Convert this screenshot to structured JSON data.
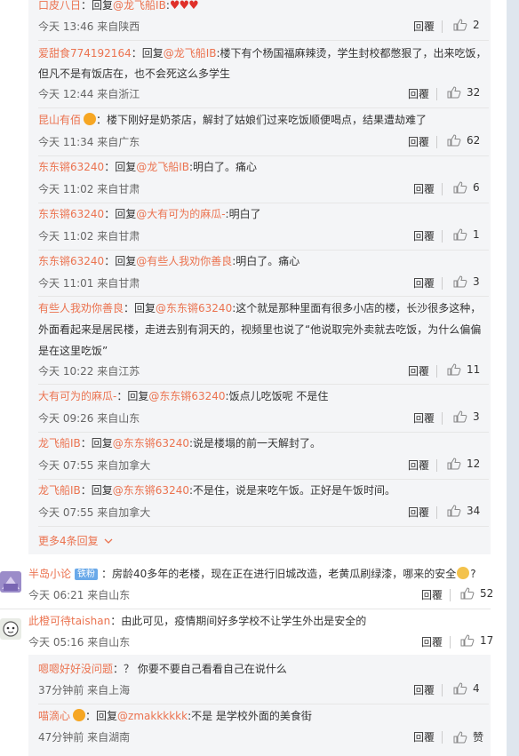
{
  "reply_label": "回覆",
  "nested_comments": [
    {
      "user": "口皮八日",
      "prefix": "：回复",
      "mention": "@龙飞船IB",
      "content": ":",
      "time": "今天 13:46 来自陕西",
      "likes": "2",
      "has_hearts": true
    },
    {
      "user": "爱甜食774192164",
      "prefix": "：回复",
      "mention": "@龙飞船IB",
      "content": ":楼下有个杨国福麻辣烫，学生封校都憋狠了，出来吃饭，",
      "content2": "但凡不是有饭店在，也不会死这么多学生",
      "time": "今天 12:44 来自浙江",
      "likes": "32"
    },
    {
      "user": "昆山有佰",
      "prefix": "：",
      "mention": "",
      "content": "楼下刚好是奶茶店，解封了姑娘们过来吃饭顺便喝点，结果遭劫难了",
      "time": "今天 11:34 来自广东",
      "likes": "62",
      "has_vbadge": true
    },
    {
      "user": "东东锵63240",
      "prefix": "：回复",
      "mention": "@龙飞船IB",
      "content": ":明白了。痛心",
      "time": "今天 11:02 来自甘肃",
      "likes": "6"
    },
    {
      "user": "东东锵63240",
      "prefix": "：回复",
      "mention": "@大有可为的麻瓜-",
      "content": ":明白了",
      "time": "今天 11:02 来自甘肃",
      "likes": "1"
    },
    {
      "user": "东东锵63240",
      "prefix": "：回复",
      "mention": "@有些人我劝你善良",
      "content": ":明白了。痛心",
      "time": "今天 11:01 来自甘肃",
      "likes": "3"
    },
    {
      "user": "有些人我劝你善良",
      "prefix": "：回复",
      "mention": "@东东锵63240",
      "content": ":这个就是那种里面有很多小店的楼，长沙很多这种，",
      "content2": "外面看起来是居民楼，走进去别有洞天的，视频里也说了“他说取完外卖就去吃饭，为什么偏偏",
      "content3": "是在这里吃饭”",
      "time": "今天 10:22 来自江苏",
      "likes": "11"
    },
    {
      "user": "大有可为的麻瓜-",
      "prefix": "：回复",
      "mention": "@东东锵63240",
      "content": ":饭点儿吃饭呢 不是住",
      "time": "今天 09:26 来自山东",
      "likes": "3"
    },
    {
      "user": "龙飞船IB",
      "prefix": "：回复",
      "mention": "@东东锵63240",
      "content": ":说是楼塌的前一天解封了。",
      "time": "今天 07:55 来自加拿大",
      "likes": "12"
    },
    {
      "user": "龙飞船IB",
      "prefix": "：回复",
      "mention": "@东东锵63240",
      "content": ":不是住，说是来吃午饭。正好是午饭时间。",
      "time": "今天 07:55 来自加拿大",
      "likes": "34"
    }
  ],
  "more_replies": "更多4条回复",
  "top_comments": [
    {
      "user": "半岛小论",
      "badge": "铁粉",
      "content": "：房龄40多年的老楼，现在正在进行旧城改造，老黄瓜刷绿漆，哪来的安全",
      "tail": "?",
      "time": "今天 06:21 来自山东",
      "likes": "52"
    },
    {
      "user": "此橙可待taishan",
      "content": "：由此可见，疫情期间好多学校不让学生外出是安全的",
      "time": "今天 05:16 来自山东",
      "likes": "17"
    }
  ],
  "sub_comments": [
    {
      "user": "嗯嗯好好没问题",
      "content": "：？ 你要不要自己看看自己在说什么",
      "time": "37分钟前 来自上海",
      "likes": "4"
    },
    {
      "user": "喵滴心",
      "prefix": "：回复",
      "mention": "@zmakkkkkk",
      "content": ":不是 是学校外面的美食街",
      "time": "47分钟前 来自湖南",
      "likes": "赞",
      "has_vbadge": true
    }
  ]
}
